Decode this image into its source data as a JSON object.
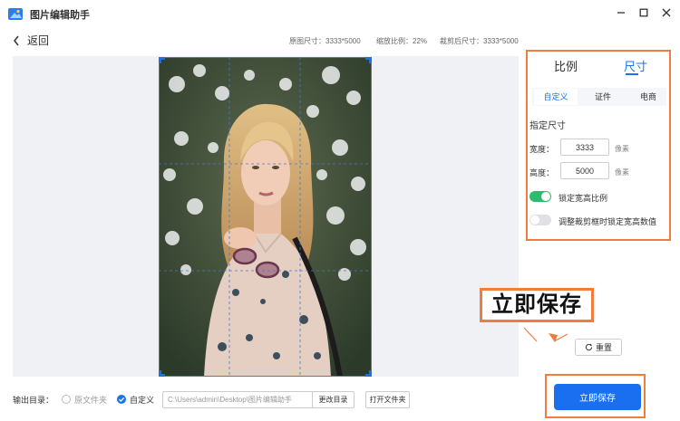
{
  "window": {
    "title": "图片编辑助手",
    "minimize_icon": "minimize-icon",
    "maximize_icon": "maximize-icon",
    "close_icon": "close-icon"
  },
  "header": {
    "back_label": "返回",
    "original_size": "原图尺寸：3333*5000",
    "zoom_ratio": "缩放比例：22%",
    "cropped_size": "裁剪后尺寸：3333*5000"
  },
  "panel": {
    "tabs": [
      {
        "label": "比例",
        "active": false
      },
      {
        "label": "尺寸",
        "active": true
      }
    ],
    "subtabs": [
      {
        "label": "自定义",
        "active": true
      },
      {
        "label": "证件",
        "active": false
      },
      {
        "label": "电商",
        "active": false
      }
    ],
    "section_title": "指定尺寸",
    "width": {
      "label": "宽度：",
      "value": "3333",
      "unit": "像素"
    },
    "height": {
      "label": "高度：",
      "value": "5000",
      "unit": "像素"
    },
    "toggles": [
      {
        "label": "锁定宽高比例",
        "on": true
      },
      {
        "label": "调整裁剪框时锁定宽高数值",
        "on": false
      }
    ]
  },
  "annotation": {
    "label": "立即保存"
  },
  "actions": {
    "reset_label": "重置",
    "save_label": "立即保存"
  },
  "output": {
    "label": "输出目录：",
    "options": [
      {
        "label": "原文件夹",
        "selected": false
      },
      {
        "label": "自定义",
        "selected": true
      }
    ],
    "path": "C:\\Users\\admin\\Desktop\\图片编辑助手",
    "change_dir_label": "更改目录",
    "open_folder_label": "打开文件夹"
  },
  "colors": {
    "accent": "#1a73e8",
    "save_button": "#1a6ef0",
    "highlight_border": "#f07c3e",
    "toggle_on": "#2dbb6e"
  }
}
